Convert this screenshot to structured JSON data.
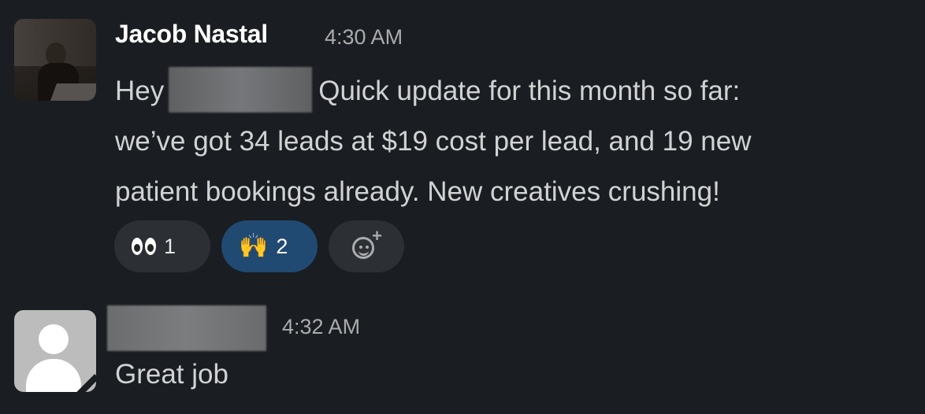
{
  "messages": [
    {
      "author": "Jacob Nastal",
      "time": "4:30 AM",
      "lines": [
        {
          "before": "Hey",
          "after": "Quick update for this month so far:"
        },
        {
          "text": "we’ve got 34 leads at $19 cost per lead, and 19 new"
        },
        {
          "text": "patient bookings already. New creatives crushing!"
        }
      ],
      "reactions": [
        {
          "emoji": "eyes-icon",
          "count": "1",
          "active": false
        },
        {
          "emoji": "raised-hands-icon",
          "count": "2",
          "active": true
        }
      ],
      "add_reaction_icon": "add-reaction-icon"
    },
    {
      "author": "",
      "time": "4:32 AM",
      "text": "Great job"
    }
  ],
  "colors": {
    "background": "#1a1d21",
    "reaction_bg": "#2c2f33",
    "reaction_active_bg": "#204a72",
    "text": "#d1d2d3",
    "timestamp": "#ababad"
  }
}
